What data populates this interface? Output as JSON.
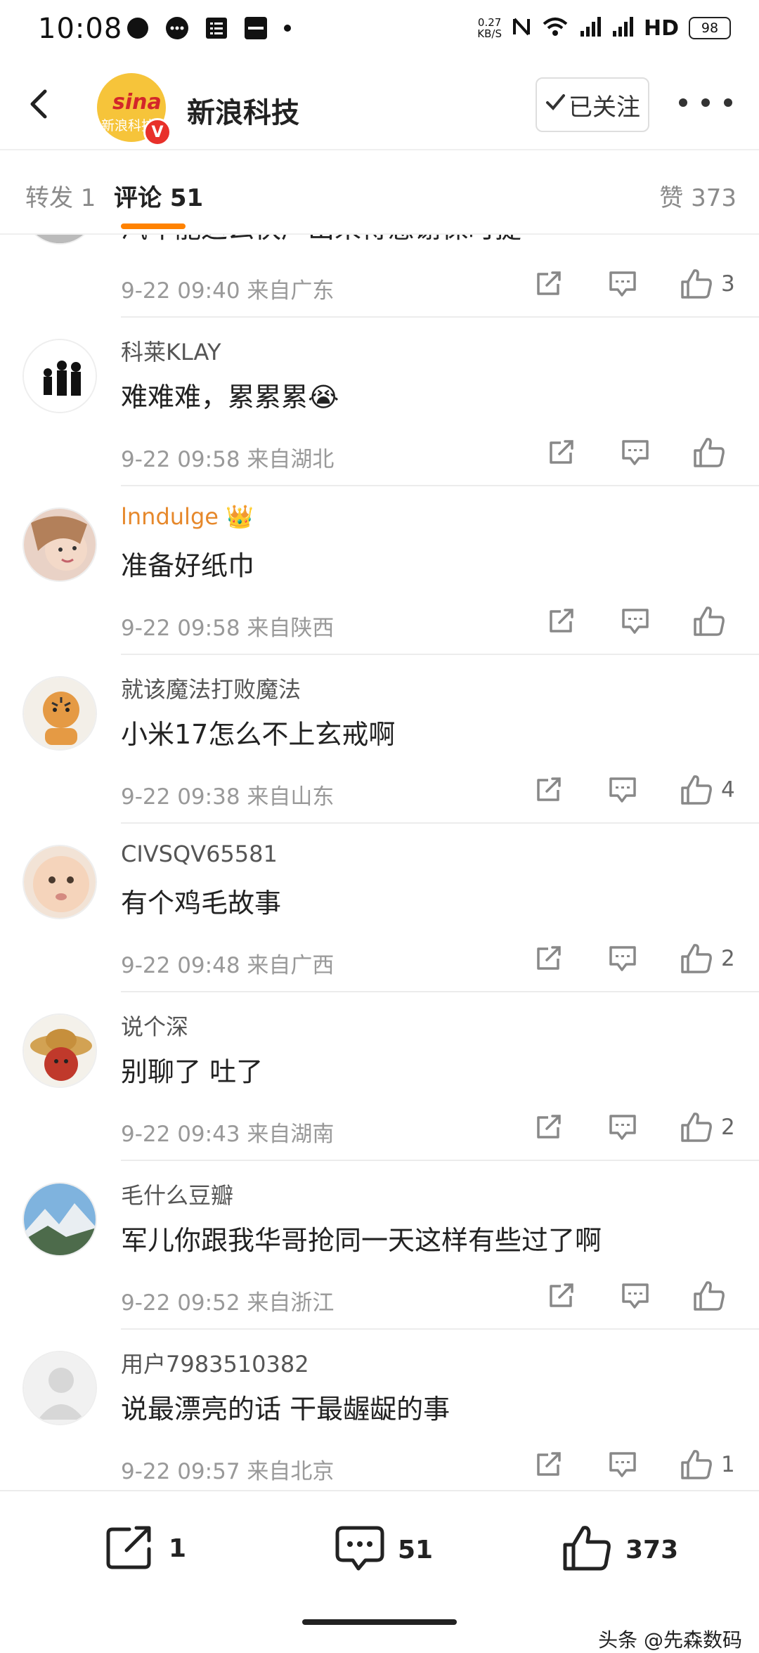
{
  "status_bar": {
    "time": "10:08",
    "notification_icons": [
      "circle-icon",
      "chat-bubble-icon",
      "list-icon",
      "xiaohongshu-icon",
      "dot-icon"
    ],
    "speed": "0.27",
    "speed_unit": "KB/S",
    "network": "HD",
    "battery": "98"
  },
  "header": {
    "title": "新浪科技",
    "avatar_brand": "sina",
    "avatar_cn": "新浪科技",
    "verified_badge": "V",
    "follow_label": "已关注"
  },
  "tabs": {
    "repost": "转发 1",
    "comments": "评论 51",
    "likes": "赞 373"
  },
  "comments": [
    {
      "user": "",
      "text": "汽车能这么快产出来得感谢保时捷",
      "time": "9-22 09:40",
      "location": "来自广东",
      "likes": "3",
      "avatar_icon": "gray-avatar"
    },
    {
      "user": "科莱KLAY",
      "text": "难难难，累累累😭",
      "time": "9-22 09:58",
      "location": "来自湖北",
      "likes": "",
      "avatar_icon": "silhouette-avatar"
    },
    {
      "user": "lnndulge",
      "text": "准备好纸巾",
      "time": "9-22 09:58",
      "location": "来自陕西",
      "likes": "",
      "avatar_icon": "girl-avatar",
      "vip": true,
      "crown": "👑"
    },
    {
      "user": "就该魔法打败魔法",
      "text": "小米17怎么不上玄戒啊",
      "time": "9-22 09:38",
      "location": "来自山东",
      "likes": "4",
      "avatar_icon": "tiger-avatar"
    },
    {
      "user": "CIVSQV65581",
      "text": "有个鸡毛故事",
      "time": "9-22 09:48",
      "location": "来自广西",
      "likes": "2",
      "avatar_icon": "baby-avatar"
    },
    {
      "user": "说个深",
      "text": "别聊了  吐了",
      "time": "9-22 09:43",
      "location": "来自湖南",
      "likes": "2",
      "avatar_icon": "straw-hat-avatar"
    },
    {
      "user": "毛什么豆瓣",
      "text": "军儿你跟我华哥抢同一天这样有些过了啊",
      "time": "9-22 09:52",
      "location": "来自浙江",
      "likes": "",
      "avatar_icon": "mountain-avatar"
    },
    {
      "user": "用户7983510382",
      "text": "说最漂亮的话 干最龌龊的事",
      "time": "9-22 09:57",
      "location": "来自北京",
      "likes": "1",
      "avatar_icon": "default-avatar"
    }
  ],
  "bottom_bar": {
    "repost_count": "1",
    "comment_count": "51",
    "like_count": "373"
  },
  "watermark": "头条 @先森数码",
  "colors": {
    "accent": "#ff8200",
    "vip_name": "#e6882b",
    "verified": "#e8302a"
  }
}
